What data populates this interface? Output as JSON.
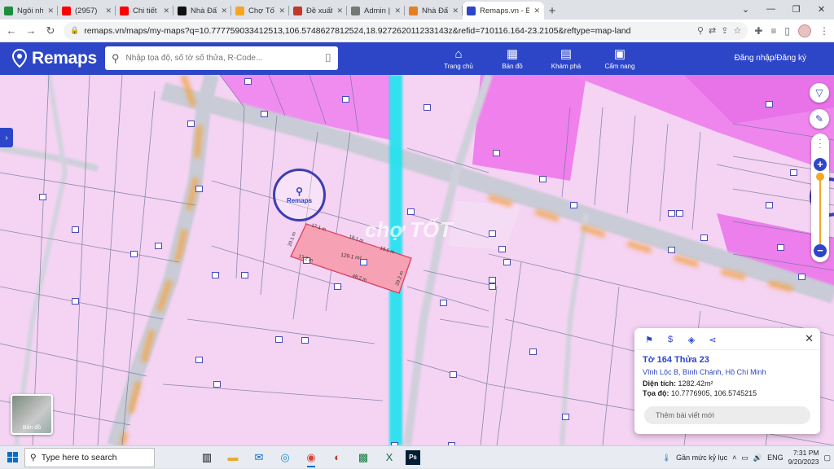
{
  "browser": {
    "tabs": [
      {
        "title": "Ngôi nhà onli",
        "fav_color": "#1e8e3e",
        "fav_icon": "house"
      },
      {
        "title": "(2957)",
        "fav_color": "#ff0000",
        "fav_icon": "youtube"
      },
      {
        "title": "Chi tiết video",
        "fav_color": "#ff0000",
        "fav_icon": "youtube"
      },
      {
        "title": "Nhà Đất Hậu",
        "fav_color": "#111111",
        "fav_icon": "tiktok"
      },
      {
        "title": "Chợ Tốt - Đăn",
        "fav_color": "#f5a623",
        "fav_icon": "chotot"
      },
      {
        "title": "Đề xuất Bình",
        "fav_color": "#c0392b",
        "fav_icon": "document"
      },
      {
        "title": "Admin | Nhà Đ",
        "fav_color": "#777777",
        "fav_icon": "globe"
      },
      {
        "title": "Nhà Đất Hậu",
        "fav_color": "#e67e22",
        "fav_icon": "tag"
      },
      {
        "title": "Remaps.vn - B",
        "fav_color": "#2d46c8",
        "fav_icon": "remaps",
        "active": true
      }
    ],
    "new_tab": "+",
    "url": "remaps.vn/maps/my-maps?q=10.777759033412513,106.5748627812524,18.927262011233143z&refid=710116.164-23.2105&reftype=map-land"
  },
  "app": {
    "brand": "Remaps",
    "search_placeholder": "Nhập tọa độ, số tờ số thửa, R-Code...",
    "nav": [
      {
        "label": "Trang chủ",
        "icon": "home-icon",
        "glyph": "⌂"
      },
      {
        "label": "Bản đồ",
        "icon": "map-icon",
        "glyph": "▦"
      },
      {
        "label": "Khám phá",
        "icon": "explore-icon",
        "glyph": "▤"
      },
      {
        "label": "Cẩm nang",
        "icon": "handbook-icon",
        "glyph": "▣"
      }
    ],
    "login": "Đăng nhập/Đăng ký"
  },
  "map": {
    "parcel_labels": {
      "top": "17.1 m",
      "mid_top": "18.1 m",
      "right_top": "18.5 m",
      "left": "20.1 m",
      "left_low": "17.2 m",
      "area": "129.1 m²",
      "bottom": "48.2 m",
      "right": "29.2 m"
    },
    "basemap_label": "Bản đồ",
    "watermark": "Remaps",
    "chotot_watermark": "chợ TỐT"
  },
  "info_card": {
    "title": "Tờ 164 Thửa 23",
    "address": "Vĩnh Lộc B, Bình Chánh, Hồ Chí Minh",
    "area_label": "Diện tích:",
    "area_value": "1282.42m²",
    "coord_label": "Tọa độ:",
    "coord_value": "10.7776905, 106.5745215",
    "post_button": "Thêm bài viết mới"
  },
  "taskbar": {
    "search_placeholder": "Type here to search",
    "weather": "Gần mức kỷ lục",
    "lang": "ENG",
    "time": "7:31 PM",
    "date": "9/20/2023"
  }
}
